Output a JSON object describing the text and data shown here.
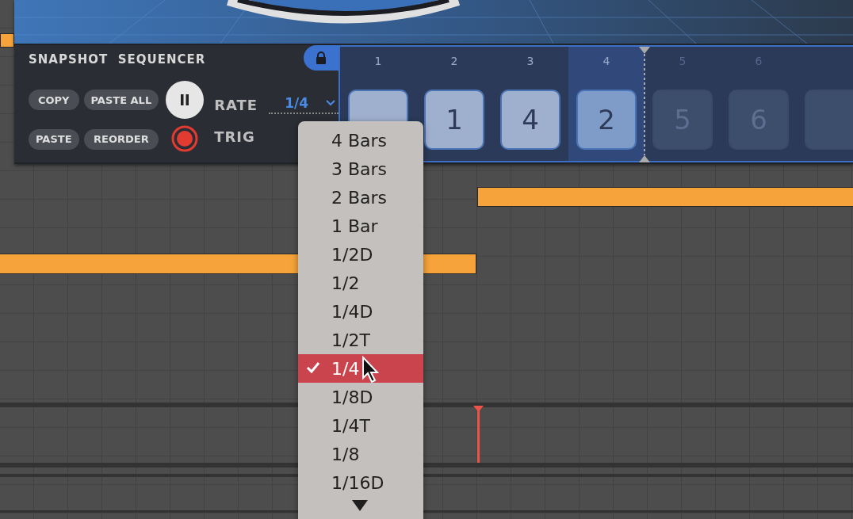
{
  "sequencer": {
    "title": "SNAPSHOT  SEQUENCER",
    "locked": true,
    "playing": true,
    "record_armed": true,
    "buttons": [
      {
        "label": "COPY"
      },
      {
        "label": "PASTE ALL"
      },
      {
        "label": "PASTE"
      },
      {
        "label": "REORDER"
      }
    ],
    "rate": {
      "label": "RATE",
      "value": "1/4"
    },
    "trig": {
      "label": "TRIG"
    },
    "steps": [
      {
        "number": "1",
        "active": true,
        "selected": false
      },
      {
        "number": "2",
        "value": "1",
        "active": true,
        "selected": false
      },
      {
        "number": "3",
        "value": "4",
        "active": true,
        "selected": false
      },
      {
        "number": "4",
        "value": "2",
        "active": true,
        "selected": true
      },
      {
        "number": "5",
        "value": "5",
        "active": false,
        "selected": false
      },
      {
        "number": "6",
        "value": "6",
        "active": false,
        "selected": false
      },
      {
        "active": false,
        "selected": false
      }
    ]
  },
  "rate_menu": {
    "more_below": true,
    "items": [
      {
        "label": "4 Bars",
        "selected": false
      },
      {
        "label": "3 Bars",
        "selected": false
      },
      {
        "label": "2 Bars",
        "selected": false
      },
      {
        "label": "1 Bar",
        "selected": false
      },
      {
        "label": "1/2D",
        "selected": false
      },
      {
        "label": "1/2",
        "selected": false
      },
      {
        "label": "1/4D",
        "selected": false
      },
      {
        "label": "1/2T",
        "selected": false
      },
      {
        "label": "1/4",
        "selected": true
      },
      {
        "label": "1/8D",
        "selected": false
      },
      {
        "label": "1/4T",
        "selected": false
      },
      {
        "label": "1/8",
        "selected": false
      },
      {
        "label": "1/16D",
        "selected": false
      }
    ]
  }
}
